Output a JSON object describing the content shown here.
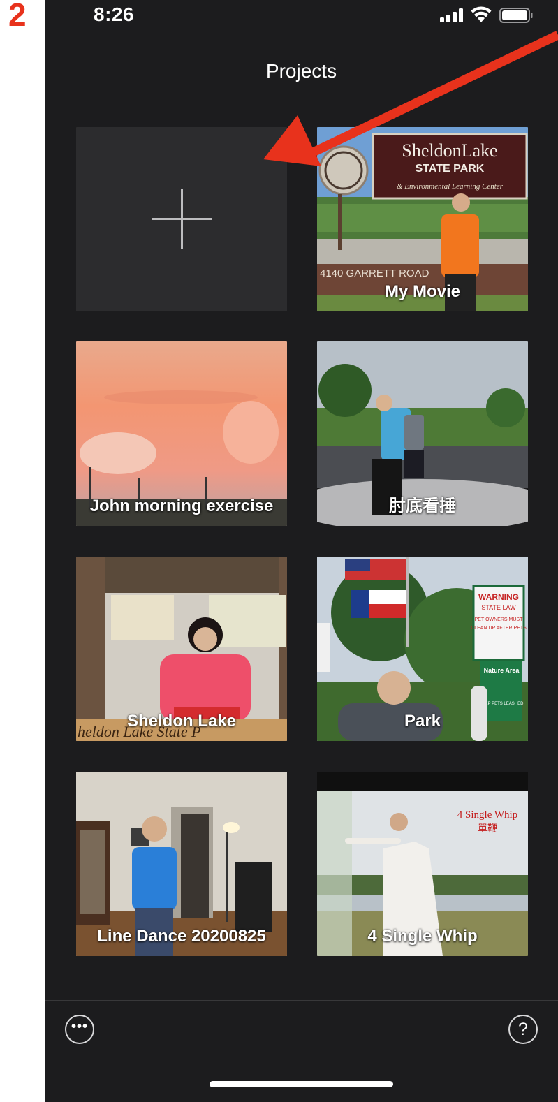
{
  "step_number": "2",
  "status_bar": {
    "time": "8:26"
  },
  "nav": {
    "title": "Projects"
  },
  "new_project": {
    "icon": "plus-icon"
  },
  "projects": [
    {
      "label": "My Movie"
    },
    {
      "label": "John morning exercise"
    },
    {
      "label": "肘底看捶"
    },
    {
      "label": "Sheldon Lake"
    },
    {
      "label": "Park"
    },
    {
      "label": "Line Dance 20200825"
    },
    {
      "label": "4 Single Whip"
    }
  ],
  "thumb_text": {
    "sign_title": "SheldonLake",
    "sign_sub": "STATE  PARK",
    "sign_caption": "& Environmental Learning Center",
    "sign_address": "4140 GARRETT ROAD",
    "whip_title": "4 Single Whip",
    "whip_chinese": "單鞭",
    "banner_text": "heldon Lake State P",
    "warning_title": "WARNING",
    "warning_sub": "STATE LAW",
    "warning_line1": "PET OWNERS MUST",
    "warning_line2": "CLEAN UP AFTER PETS",
    "nature_title": "Nature Area",
    "nature_line": "KEEP PETS LEASHED"
  },
  "toolbar": {
    "more_label": "•••",
    "help_label": "?"
  },
  "colors": {
    "accent_annotation": "#e8321c",
    "background": "#1c1c1e"
  }
}
